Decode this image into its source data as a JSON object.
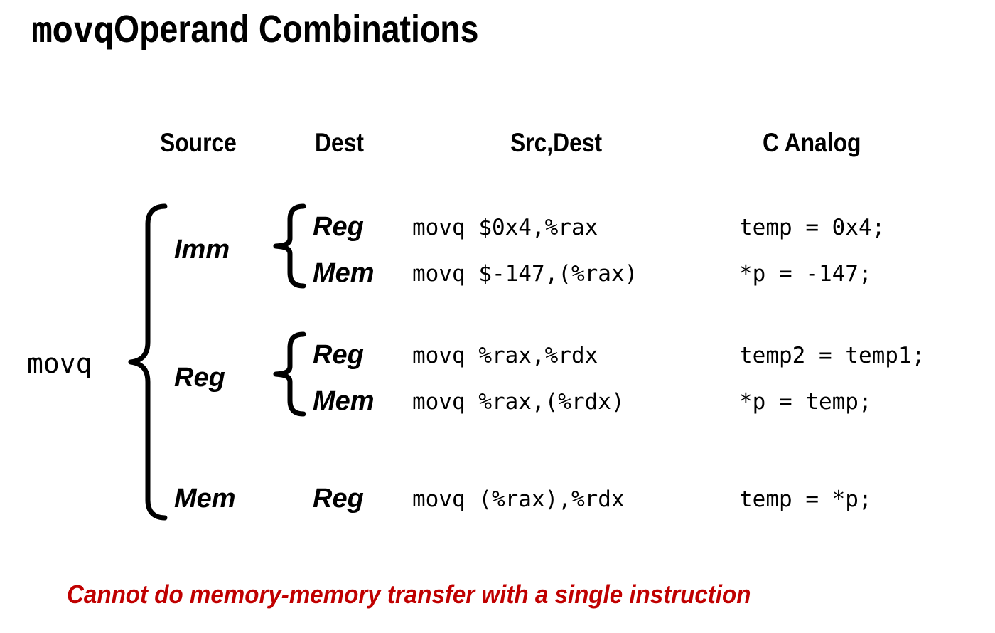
{
  "title": {
    "mono_part": "movq",
    "sans_part": " Operand Combinations"
  },
  "headers": {
    "source": "Source",
    "dest": "Dest",
    "src_dest": "Src,Dest",
    "c_analog": "C Analog"
  },
  "instruction_label": "movq",
  "groups": [
    {
      "source": "Imm",
      "rows": [
        {
          "dest": "Reg",
          "asm": "movq $0x4,%rax",
          "c": "temp = 0x4;"
        },
        {
          "dest": "Mem",
          "asm": "movq $-147,(%rax)",
          "c": "*p = -147;"
        }
      ]
    },
    {
      "source": "Reg",
      "rows": [
        {
          "dest": "Reg",
          "asm": "movq %rax,%rdx",
          "c": "temp2 = temp1;"
        },
        {
          "dest": "Mem",
          "asm": "movq %rax,(%rdx)",
          "c": "*p = temp;"
        }
      ]
    },
    {
      "source": "Mem",
      "rows": [
        {
          "dest": "Reg",
          "asm": "movq (%rax),%rdx",
          "c": "temp = *p;"
        }
      ]
    }
  ],
  "footer": {
    "note": "Cannot do memory-memory transfer with a single instruction",
    "color": "#C00000"
  },
  "colors": {
    "background": "#FFFFFF",
    "text": "#000000",
    "accent_red": "#C00000"
  }
}
